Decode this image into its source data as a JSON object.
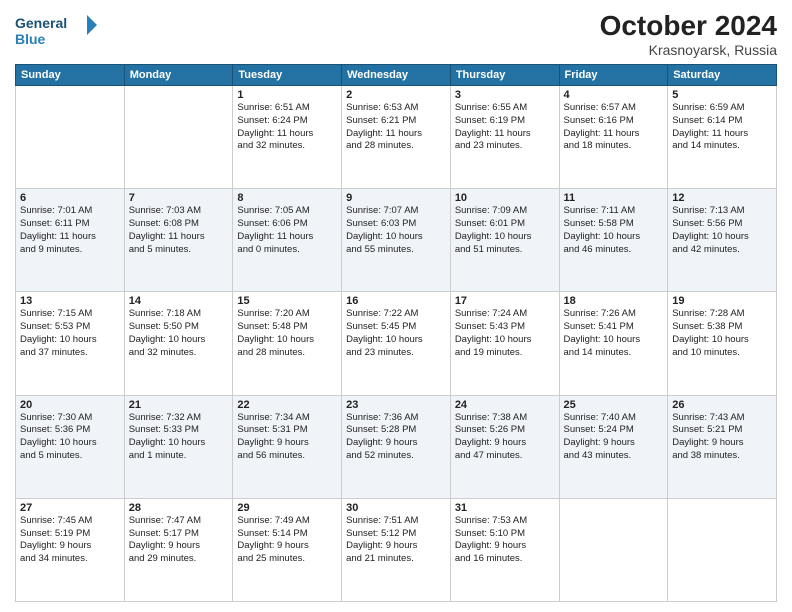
{
  "header": {
    "logo_line1": "General",
    "logo_line2": "Blue",
    "month_year": "October 2024",
    "location": "Krasnoyarsk, Russia"
  },
  "days_of_week": [
    "Sunday",
    "Monday",
    "Tuesday",
    "Wednesday",
    "Thursday",
    "Friday",
    "Saturday"
  ],
  "weeks": [
    [
      {
        "day": "",
        "info": ""
      },
      {
        "day": "",
        "info": ""
      },
      {
        "day": "1",
        "info": "Sunrise: 6:51 AM\nSunset: 6:24 PM\nDaylight: 11 hours\nand 32 minutes."
      },
      {
        "day": "2",
        "info": "Sunrise: 6:53 AM\nSunset: 6:21 PM\nDaylight: 11 hours\nand 28 minutes."
      },
      {
        "day": "3",
        "info": "Sunrise: 6:55 AM\nSunset: 6:19 PM\nDaylight: 11 hours\nand 23 minutes."
      },
      {
        "day": "4",
        "info": "Sunrise: 6:57 AM\nSunset: 6:16 PM\nDaylight: 11 hours\nand 18 minutes."
      },
      {
        "day": "5",
        "info": "Sunrise: 6:59 AM\nSunset: 6:14 PM\nDaylight: 11 hours\nand 14 minutes."
      }
    ],
    [
      {
        "day": "6",
        "info": "Sunrise: 7:01 AM\nSunset: 6:11 PM\nDaylight: 11 hours\nand 9 minutes."
      },
      {
        "day": "7",
        "info": "Sunrise: 7:03 AM\nSunset: 6:08 PM\nDaylight: 11 hours\nand 5 minutes."
      },
      {
        "day": "8",
        "info": "Sunrise: 7:05 AM\nSunset: 6:06 PM\nDaylight: 11 hours\nand 0 minutes."
      },
      {
        "day": "9",
        "info": "Sunrise: 7:07 AM\nSunset: 6:03 PM\nDaylight: 10 hours\nand 55 minutes."
      },
      {
        "day": "10",
        "info": "Sunrise: 7:09 AM\nSunset: 6:01 PM\nDaylight: 10 hours\nand 51 minutes."
      },
      {
        "day": "11",
        "info": "Sunrise: 7:11 AM\nSunset: 5:58 PM\nDaylight: 10 hours\nand 46 minutes."
      },
      {
        "day": "12",
        "info": "Sunrise: 7:13 AM\nSunset: 5:56 PM\nDaylight: 10 hours\nand 42 minutes."
      }
    ],
    [
      {
        "day": "13",
        "info": "Sunrise: 7:15 AM\nSunset: 5:53 PM\nDaylight: 10 hours\nand 37 minutes."
      },
      {
        "day": "14",
        "info": "Sunrise: 7:18 AM\nSunset: 5:50 PM\nDaylight: 10 hours\nand 32 minutes."
      },
      {
        "day": "15",
        "info": "Sunrise: 7:20 AM\nSunset: 5:48 PM\nDaylight: 10 hours\nand 28 minutes."
      },
      {
        "day": "16",
        "info": "Sunrise: 7:22 AM\nSunset: 5:45 PM\nDaylight: 10 hours\nand 23 minutes."
      },
      {
        "day": "17",
        "info": "Sunrise: 7:24 AM\nSunset: 5:43 PM\nDaylight: 10 hours\nand 19 minutes."
      },
      {
        "day": "18",
        "info": "Sunrise: 7:26 AM\nSunset: 5:41 PM\nDaylight: 10 hours\nand 14 minutes."
      },
      {
        "day": "19",
        "info": "Sunrise: 7:28 AM\nSunset: 5:38 PM\nDaylight: 10 hours\nand 10 minutes."
      }
    ],
    [
      {
        "day": "20",
        "info": "Sunrise: 7:30 AM\nSunset: 5:36 PM\nDaylight: 10 hours\nand 5 minutes."
      },
      {
        "day": "21",
        "info": "Sunrise: 7:32 AM\nSunset: 5:33 PM\nDaylight: 10 hours\nand 1 minute."
      },
      {
        "day": "22",
        "info": "Sunrise: 7:34 AM\nSunset: 5:31 PM\nDaylight: 9 hours\nand 56 minutes."
      },
      {
        "day": "23",
        "info": "Sunrise: 7:36 AM\nSunset: 5:28 PM\nDaylight: 9 hours\nand 52 minutes."
      },
      {
        "day": "24",
        "info": "Sunrise: 7:38 AM\nSunset: 5:26 PM\nDaylight: 9 hours\nand 47 minutes."
      },
      {
        "day": "25",
        "info": "Sunrise: 7:40 AM\nSunset: 5:24 PM\nDaylight: 9 hours\nand 43 minutes."
      },
      {
        "day": "26",
        "info": "Sunrise: 7:43 AM\nSunset: 5:21 PM\nDaylight: 9 hours\nand 38 minutes."
      }
    ],
    [
      {
        "day": "27",
        "info": "Sunrise: 7:45 AM\nSunset: 5:19 PM\nDaylight: 9 hours\nand 34 minutes."
      },
      {
        "day": "28",
        "info": "Sunrise: 7:47 AM\nSunset: 5:17 PM\nDaylight: 9 hours\nand 29 minutes."
      },
      {
        "day": "29",
        "info": "Sunrise: 7:49 AM\nSunset: 5:14 PM\nDaylight: 9 hours\nand 25 minutes."
      },
      {
        "day": "30",
        "info": "Sunrise: 7:51 AM\nSunset: 5:12 PM\nDaylight: 9 hours\nand 21 minutes."
      },
      {
        "day": "31",
        "info": "Sunrise: 7:53 AM\nSunset: 5:10 PM\nDaylight: 9 hours\nand 16 minutes."
      },
      {
        "day": "",
        "info": ""
      },
      {
        "day": "",
        "info": ""
      }
    ]
  ]
}
